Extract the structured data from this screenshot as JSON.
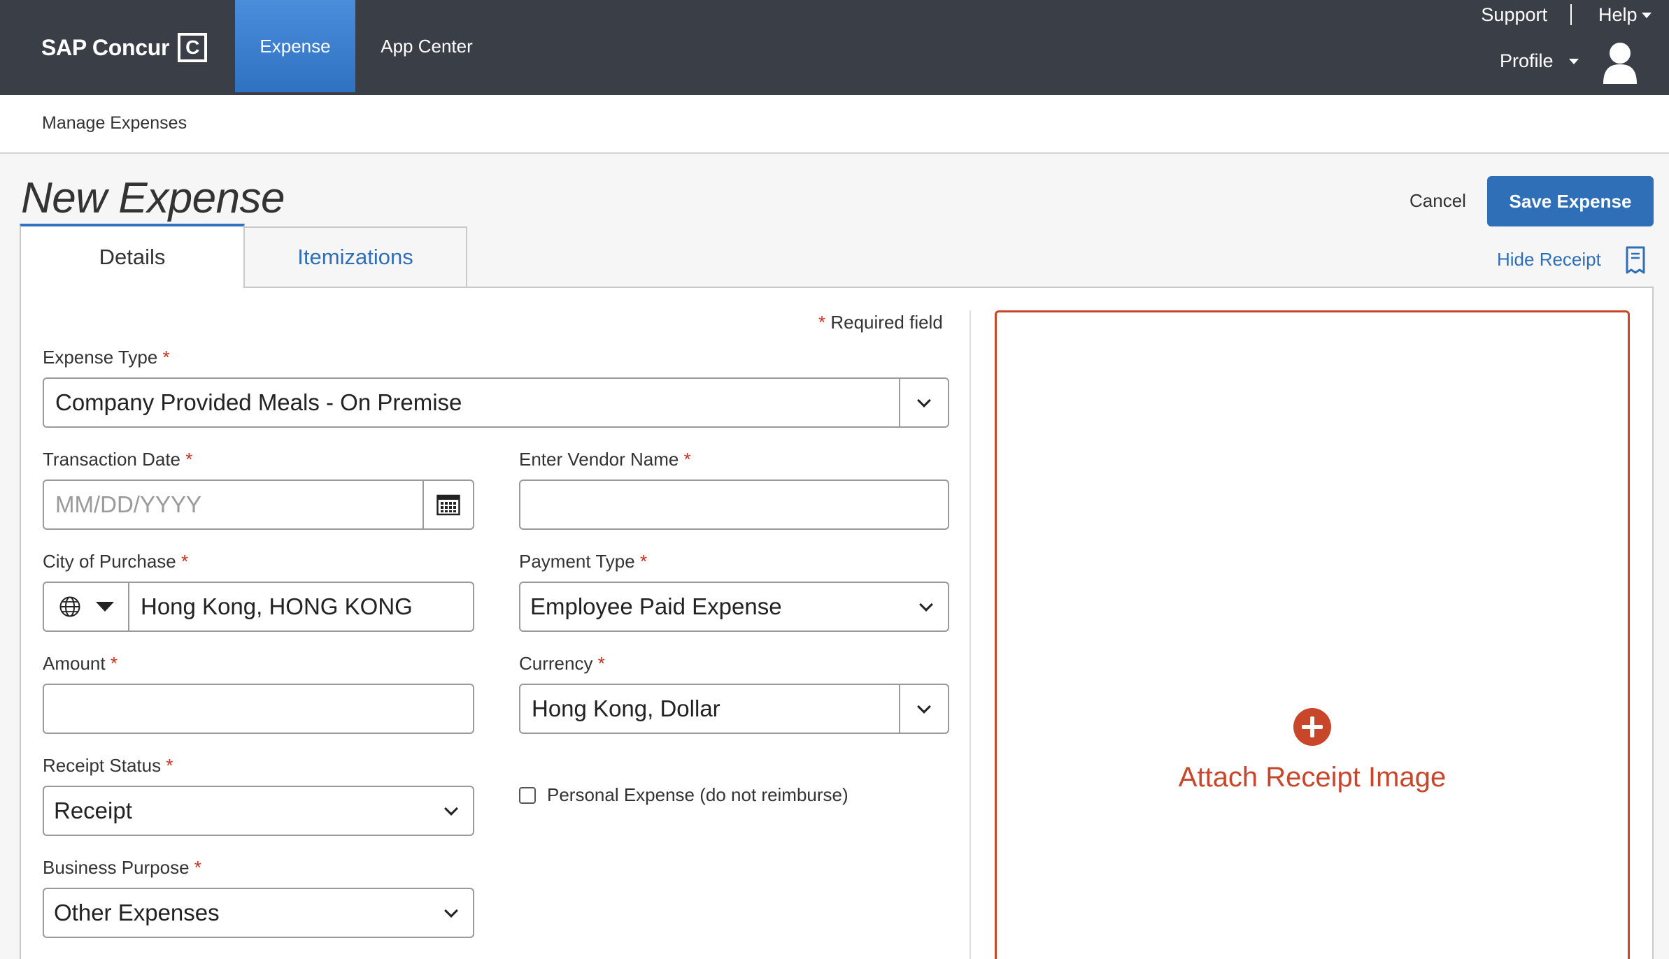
{
  "brand": {
    "name": "SAP Concur",
    "mark": "C"
  },
  "nav": {
    "tabs": [
      {
        "label": "Expense",
        "active": true
      },
      {
        "label": "App Center",
        "active": false
      }
    ]
  },
  "utility": {
    "support": "Support",
    "help": "Help",
    "profile": "Profile"
  },
  "breadcrumb": {
    "label": "Manage Expenses"
  },
  "page": {
    "title": "New Expense",
    "cancel": "Cancel",
    "save": "Save Expense"
  },
  "tabs": {
    "details": "Details",
    "itemizations": "Itemizations",
    "hide_receipt": "Hide Receipt"
  },
  "form": {
    "required_note": "Required field",
    "required_star": "*",
    "expense_type": {
      "label": "Expense Type",
      "value": "Company Provided Meals - On Premise"
    },
    "transaction_date": {
      "label": "Transaction Date",
      "placeholder": "MM/DD/YYYY",
      "value": ""
    },
    "vendor_name": {
      "label": "Enter Vendor Name",
      "value": ""
    },
    "city": {
      "label": "City of Purchase",
      "value": "Hong Kong, HONG KONG"
    },
    "payment_type": {
      "label": "Payment Type",
      "value": "Employee Paid Expense"
    },
    "amount": {
      "label": "Amount",
      "value": ""
    },
    "currency": {
      "label": "Currency",
      "value": "Hong Kong, Dollar"
    },
    "receipt_status": {
      "label": "Receipt Status",
      "value": "Receipt"
    },
    "personal_expense": {
      "label": "Personal Expense (do not reimburse)",
      "checked": false
    },
    "business_purpose": {
      "label": "Business Purpose",
      "value": "Other Expenses"
    }
  },
  "receipt": {
    "attach_label": "Attach Receipt Image"
  },
  "colors": {
    "topbar": "#3a3f47",
    "accent": "#2f72c2",
    "required": "#c8341f",
    "receipt": "#c8472a"
  },
  "icons": [
    "brand-logo-icon",
    "caret-down-icon",
    "avatar-icon",
    "receipt-icon",
    "chevron-down-icon",
    "calendar-icon",
    "globe-icon",
    "triangle-down-icon",
    "plus-circle-icon"
  ]
}
